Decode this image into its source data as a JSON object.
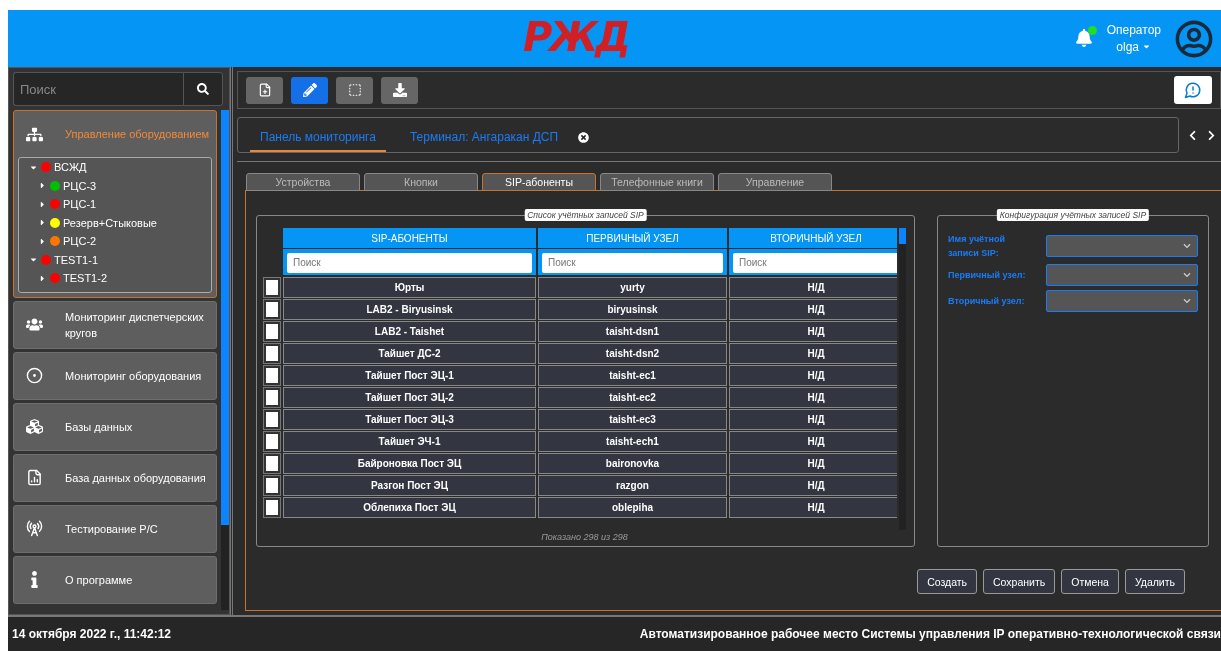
{
  "header": {
    "logo": "РЖД",
    "notification_dot": true,
    "user_role": "Оператор",
    "user_name": "olga"
  },
  "sidebar": {
    "search": {
      "placeholder": "Поиск"
    },
    "items": [
      {
        "label": "Управление оборудованием",
        "selected": true,
        "tree": [
          {
            "label": "ВСЖД",
            "color": "#ff0000",
            "expanded": true,
            "children": [
              {
                "label": "РЦС-3",
                "color": "#00c000",
                "expanded": false
              },
              {
                "label": "РЦС-1",
                "color": "#ff0000",
                "expanded": false
              },
              {
                "label": "Резерв+Стыковые",
                "color": "#ffff00",
                "expanded": false
              },
              {
                "label": "РЦС-2",
                "color": "#ff7700",
                "expanded": false
              }
            ]
          },
          {
            "label": "TEST1-1",
            "color": "#ff0000",
            "expanded": true,
            "children": [
              {
                "label": "TEST1-2",
                "color": "#ff0000",
                "expanded": false
              }
            ]
          }
        ]
      },
      {
        "label": "Мониторинг диспетчерских кругов",
        "selected": false
      },
      {
        "label": "Мониторинг оборудования",
        "selected": false
      },
      {
        "label": "Базы данных",
        "selected": false
      },
      {
        "label": "База данных оборудования",
        "selected": false
      },
      {
        "label": "Тестирование Р/С",
        "selected": false
      },
      {
        "label": "О программе",
        "selected": false
      }
    ]
  },
  "toolbar": [
    {
      "selected": false
    },
    {
      "selected": true
    },
    {
      "selected": false
    },
    {
      "selected": false
    }
  ],
  "page_tabs": [
    {
      "label": "Панель мониторинга",
      "selected": true,
      "closable": false
    },
    {
      "label": "Терминал: Ангаракан ДСП",
      "selected": false,
      "closable": true
    }
  ],
  "section_tabs": [
    {
      "label": "Устройства",
      "selected": false
    },
    {
      "label": "Кнопки",
      "selected": false
    },
    {
      "label": "SIP-абоненты",
      "selected": true
    },
    {
      "label": "Телефонные книги",
      "selected": false
    },
    {
      "label": "Управление",
      "selected": false
    }
  ],
  "sip_list": {
    "title": "Список учётных записей SIP",
    "columns": [
      {
        "label": "SIP-АБОНЕНТЫ",
        "placeholder": "Поиск"
      },
      {
        "label": "ПЕРВИЧНЫЙ УЗЕЛ",
        "placeholder": "Поиск"
      },
      {
        "label": "ВТОРИЧНЫЙ УЗЕЛ",
        "placeholder": "Поиск"
      }
    ],
    "rows": [
      {
        "checked": false,
        "cells": [
          "Юрты",
          "yurty",
          "Н/Д"
        ]
      },
      {
        "checked": false,
        "cells": [
          "LAB2 - Biryusinsk",
          "biryusinsk",
          "Н/Д"
        ]
      },
      {
        "checked": false,
        "cells": [
          "LAB2 - Taishet",
          "taisht-dsn1",
          "Н/Д"
        ]
      },
      {
        "checked": false,
        "cells": [
          "Тайшет ДС-2",
          "taisht-dsn2",
          "Н/Д"
        ]
      },
      {
        "checked": false,
        "cells": [
          "Тайшет Пост ЭЦ-1",
          "taisht-ec1",
          "Н/Д"
        ]
      },
      {
        "checked": false,
        "cells": [
          "Тайшет Пост ЭЦ-2",
          "taisht-ec2",
          "Н/Д"
        ]
      },
      {
        "checked": false,
        "cells": [
          "Тайшет Пост ЭЦ-3",
          "taisht-ec3",
          "Н/Д"
        ]
      },
      {
        "checked": false,
        "cells": [
          "Тайшет ЭЧ-1",
          "taisht-ech1",
          "Н/Д"
        ]
      },
      {
        "checked": false,
        "cells": [
          "Байроновка Пост ЭЦ",
          "baironovka",
          "Н/Д"
        ]
      },
      {
        "checked": false,
        "cells": [
          "Разгон Пост ЭЦ",
          "razgon",
          "Н/Д"
        ]
      },
      {
        "checked": false,
        "cells": [
          "Облепиха Пост ЭЦ",
          "oblepiha",
          "Н/Д"
        ]
      }
    ],
    "footer": "Показано 298 из 298"
  },
  "config": {
    "title": "Конфигурация учётных записей SIP",
    "fields": [
      {
        "label": "Имя учётной записи SIP:"
      },
      {
        "label": "Первичный узел:"
      },
      {
        "label": "Вторичный узел:"
      }
    ]
  },
  "actions": [
    "Создать",
    "Сохранить",
    "Отмена",
    "Удалить"
  ],
  "status_bar": {
    "datetime": "14 октября 2022 г., 11:42:12",
    "app_title": "Автоматизированное рабочее место Системы управления IP оперативно-технологической связи"
  }
}
